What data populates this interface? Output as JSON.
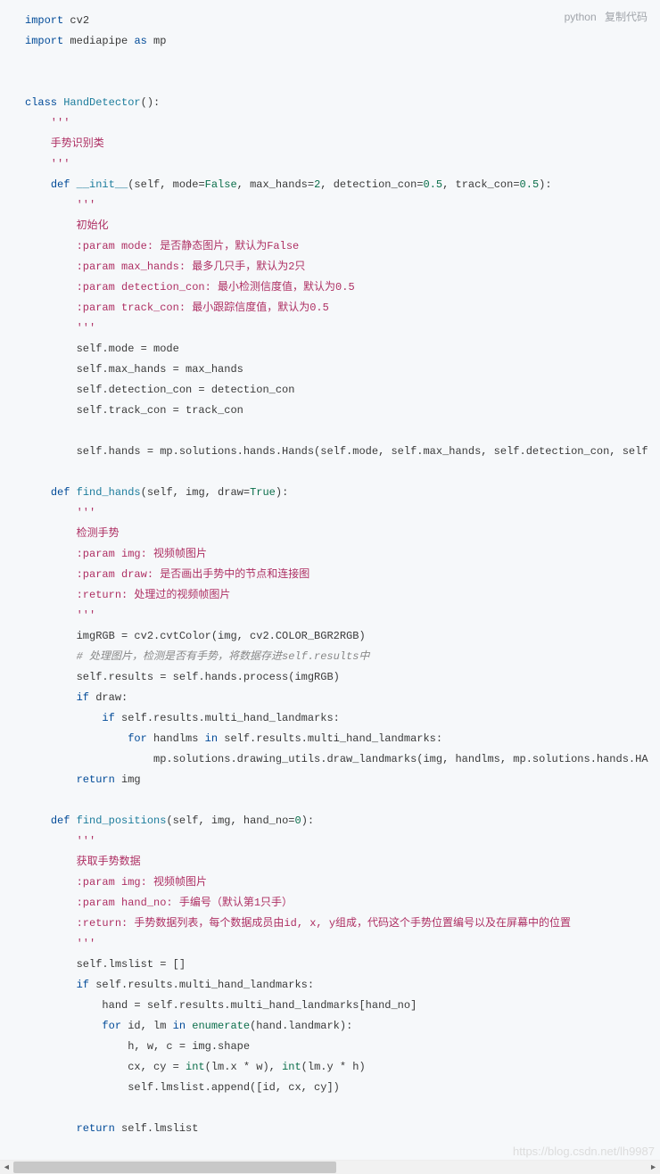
{
  "header": {
    "lang": "python",
    "copy": "复制代码"
  },
  "watermark": "https://blog.csdn.net/lh9987",
  "c": {
    "l1a": "import",
    "l1b": " cv2",
    "l2a": "import",
    "l2b": " mediapipe ",
    "l2c": "as",
    "l2d": " mp",
    "l3a": "class ",
    "l3b": "HandDetector",
    "l3c": "():",
    "l4": "    '''",
    "l5": "    手势识别类",
    "l6": "    '''",
    "l7a": "    ",
    "l7b": "def ",
    "l7c": "__init__",
    "l7d": "(self, mode=",
    "l7e": "False",
    "l7f": ", max_hands=",
    "l7g": "2",
    "l7h": ", detection_con=",
    "l7i": "0.5",
    "l7j": ", track_con=",
    "l7k": "0.5",
    "l7l": "):",
    "l8": "        '''",
    "l9": "        初始化",
    "l10": "        :param mode: 是否静态图片，默认为False",
    "l11": "        :param max_hands: 最多几只手，默认为2只",
    "l12": "        :param detection_con: 最小检测信度值，默认为0.5",
    "l13": "        :param track_con: 最小跟踪信度值，默认为0.5",
    "l14": "        '''",
    "l15": "        self.mode = mode",
    "l16": "        self.max_hands = max_hands",
    "l17": "        self.detection_con = detection_con",
    "l18": "        self.track_con = track_con",
    "l19": "        self.hands = mp.solutions.hands.Hands(self.mode, self.max_hands, self.detection_con, self",
    "l20a": "    ",
    "l20b": "def ",
    "l20c": "find_hands",
    "l20d": "(self, img, draw=",
    "l20e": "True",
    "l20f": "):",
    "l21": "        '''",
    "l22": "        检测手势",
    "l23": "        :param img: 视频帧图片",
    "l24": "        :param draw: 是否画出手势中的节点和连接图",
    "l25": "        :return: 处理过的视频帧图片",
    "l26": "        '''",
    "l27": "        imgRGB = cv2.cvtColor(img, cv2.COLOR_BGR2RGB)",
    "l28": "        # 处理图片，检测是否有手势，将数据存进self.results中",
    "l29": "        self.results = self.hands.process(imgRGB)",
    "l30a": "        ",
    "l30b": "if",
    "l30c": " draw:",
    "l31a": "            ",
    "l31b": "if",
    "l31c": " self.results.multi_hand_landmarks:",
    "l32a": "                ",
    "l32b": "for",
    "l32c": " handlms ",
    "l32d": "in",
    "l32e": " self.results.multi_hand_landmarks:",
    "l33": "                    mp.solutions.drawing_utils.draw_landmarks(img, handlms, mp.solutions.hands.HA",
    "l34a": "        ",
    "l34b": "return",
    "l34c": " img",
    "l35a": "    ",
    "l35b": "def ",
    "l35c": "find_positions",
    "l35d": "(self, img, hand_no=",
    "l35e": "0",
    "l35f": "):",
    "l36": "        '''",
    "l37": "        获取手势数据",
    "l38": "        :param img: 视频帧图片",
    "l39": "        :param hand_no: 手编号（默认第1只手）",
    "l40": "        :return: 手势数据列表，每个数据成员由id, x, y组成，代码这个手势位置编号以及在屏幕中的位置",
    "l41": "        '''",
    "l42": "        self.lmslist = []",
    "l43a": "        ",
    "l43b": "if",
    "l43c": " self.results.multi_hand_landmarks:",
    "l44": "            hand = self.results.multi_hand_landmarks[hand_no]",
    "l45a": "            ",
    "l45b": "for",
    "l45c": " id, lm ",
    "l45d": "in",
    "l45e": " ",
    "l45f": "enumerate",
    "l45g": "(hand.landmark):",
    "l46": "                h, w, c = img.shape",
    "l47a": "                cx, cy = ",
    "l47b": "int",
    "l47c": "(lm.x * w), ",
    "l47d": "int",
    "l47e": "(lm.y * h)",
    "l48": "                self.lmslist.append([id, cx, cy])",
    "l49a": "        ",
    "l49b": "return",
    "l49c": " self.lmslist"
  }
}
